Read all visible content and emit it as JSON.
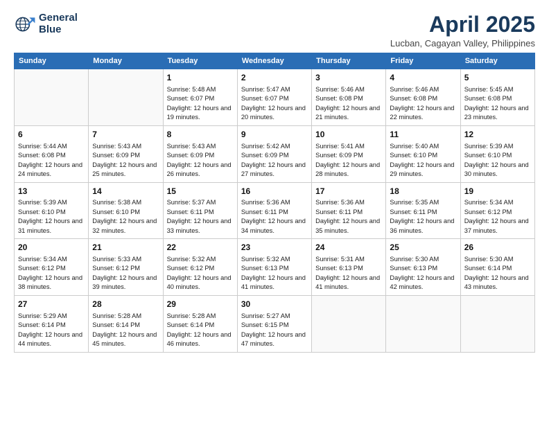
{
  "header": {
    "logo_line1": "General",
    "logo_line2": "Blue",
    "month_title": "April 2025",
    "subtitle": "Lucban, Cagayan Valley, Philippines"
  },
  "days_of_week": [
    "Sunday",
    "Monday",
    "Tuesday",
    "Wednesday",
    "Thursday",
    "Friday",
    "Saturday"
  ],
  "weeks": [
    [
      {
        "day": "",
        "sunrise": "",
        "sunset": "",
        "daylight": ""
      },
      {
        "day": "",
        "sunrise": "",
        "sunset": "",
        "daylight": ""
      },
      {
        "day": "1",
        "sunrise": "Sunrise: 5:48 AM",
        "sunset": "Sunset: 6:07 PM",
        "daylight": "Daylight: 12 hours and 19 minutes."
      },
      {
        "day": "2",
        "sunrise": "Sunrise: 5:47 AM",
        "sunset": "Sunset: 6:07 PM",
        "daylight": "Daylight: 12 hours and 20 minutes."
      },
      {
        "day": "3",
        "sunrise": "Sunrise: 5:46 AM",
        "sunset": "Sunset: 6:08 PM",
        "daylight": "Daylight: 12 hours and 21 minutes."
      },
      {
        "day": "4",
        "sunrise": "Sunrise: 5:46 AM",
        "sunset": "Sunset: 6:08 PM",
        "daylight": "Daylight: 12 hours and 22 minutes."
      },
      {
        "day": "5",
        "sunrise": "Sunrise: 5:45 AM",
        "sunset": "Sunset: 6:08 PM",
        "daylight": "Daylight: 12 hours and 23 minutes."
      }
    ],
    [
      {
        "day": "6",
        "sunrise": "Sunrise: 5:44 AM",
        "sunset": "Sunset: 6:08 PM",
        "daylight": "Daylight: 12 hours and 24 minutes."
      },
      {
        "day": "7",
        "sunrise": "Sunrise: 5:43 AM",
        "sunset": "Sunset: 6:09 PM",
        "daylight": "Daylight: 12 hours and 25 minutes."
      },
      {
        "day": "8",
        "sunrise": "Sunrise: 5:43 AM",
        "sunset": "Sunset: 6:09 PM",
        "daylight": "Daylight: 12 hours and 26 minutes."
      },
      {
        "day": "9",
        "sunrise": "Sunrise: 5:42 AM",
        "sunset": "Sunset: 6:09 PM",
        "daylight": "Daylight: 12 hours and 27 minutes."
      },
      {
        "day": "10",
        "sunrise": "Sunrise: 5:41 AM",
        "sunset": "Sunset: 6:09 PM",
        "daylight": "Daylight: 12 hours and 28 minutes."
      },
      {
        "day": "11",
        "sunrise": "Sunrise: 5:40 AM",
        "sunset": "Sunset: 6:10 PM",
        "daylight": "Daylight: 12 hours and 29 minutes."
      },
      {
        "day": "12",
        "sunrise": "Sunrise: 5:39 AM",
        "sunset": "Sunset: 6:10 PM",
        "daylight": "Daylight: 12 hours and 30 minutes."
      }
    ],
    [
      {
        "day": "13",
        "sunrise": "Sunrise: 5:39 AM",
        "sunset": "Sunset: 6:10 PM",
        "daylight": "Daylight: 12 hours and 31 minutes."
      },
      {
        "day": "14",
        "sunrise": "Sunrise: 5:38 AM",
        "sunset": "Sunset: 6:10 PM",
        "daylight": "Daylight: 12 hours and 32 minutes."
      },
      {
        "day": "15",
        "sunrise": "Sunrise: 5:37 AM",
        "sunset": "Sunset: 6:11 PM",
        "daylight": "Daylight: 12 hours and 33 minutes."
      },
      {
        "day": "16",
        "sunrise": "Sunrise: 5:36 AM",
        "sunset": "Sunset: 6:11 PM",
        "daylight": "Daylight: 12 hours and 34 minutes."
      },
      {
        "day": "17",
        "sunrise": "Sunrise: 5:36 AM",
        "sunset": "Sunset: 6:11 PM",
        "daylight": "Daylight: 12 hours and 35 minutes."
      },
      {
        "day": "18",
        "sunrise": "Sunrise: 5:35 AM",
        "sunset": "Sunset: 6:11 PM",
        "daylight": "Daylight: 12 hours and 36 minutes."
      },
      {
        "day": "19",
        "sunrise": "Sunrise: 5:34 AM",
        "sunset": "Sunset: 6:12 PM",
        "daylight": "Daylight: 12 hours and 37 minutes."
      }
    ],
    [
      {
        "day": "20",
        "sunrise": "Sunrise: 5:34 AM",
        "sunset": "Sunset: 6:12 PM",
        "daylight": "Daylight: 12 hours and 38 minutes."
      },
      {
        "day": "21",
        "sunrise": "Sunrise: 5:33 AM",
        "sunset": "Sunset: 6:12 PM",
        "daylight": "Daylight: 12 hours and 39 minutes."
      },
      {
        "day": "22",
        "sunrise": "Sunrise: 5:32 AM",
        "sunset": "Sunset: 6:12 PM",
        "daylight": "Daylight: 12 hours and 40 minutes."
      },
      {
        "day": "23",
        "sunrise": "Sunrise: 5:32 AM",
        "sunset": "Sunset: 6:13 PM",
        "daylight": "Daylight: 12 hours and 41 minutes."
      },
      {
        "day": "24",
        "sunrise": "Sunrise: 5:31 AM",
        "sunset": "Sunset: 6:13 PM",
        "daylight": "Daylight: 12 hours and 41 minutes."
      },
      {
        "day": "25",
        "sunrise": "Sunrise: 5:30 AM",
        "sunset": "Sunset: 6:13 PM",
        "daylight": "Daylight: 12 hours and 42 minutes."
      },
      {
        "day": "26",
        "sunrise": "Sunrise: 5:30 AM",
        "sunset": "Sunset: 6:14 PM",
        "daylight": "Daylight: 12 hours and 43 minutes."
      }
    ],
    [
      {
        "day": "27",
        "sunrise": "Sunrise: 5:29 AM",
        "sunset": "Sunset: 6:14 PM",
        "daylight": "Daylight: 12 hours and 44 minutes."
      },
      {
        "day": "28",
        "sunrise": "Sunrise: 5:28 AM",
        "sunset": "Sunset: 6:14 PM",
        "daylight": "Daylight: 12 hours and 45 minutes."
      },
      {
        "day": "29",
        "sunrise": "Sunrise: 5:28 AM",
        "sunset": "Sunset: 6:14 PM",
        "daylight": "Daylight: 12 hours and 46 minutes."
      },
      {
        "day": "30",
        "sunrise": "Sunrise: 5:27 AM",
        "sunset": "Sunset: 6:15 PM",
        "daylight": "Daylight: 12 hours and 47 minutes."
      },
      {
        "day": "",
        "sunrise": "",
        "sunset": "",
        "daylight": ""
      },
      {
        "day": "",
        "sunrise": "",
        "sunset": "",
        "daylight": ""
      },
      {
        "day": "",
        "sunrise": "",
        "sunset": "",
        "daylight": ""
      }
    ]
  ]
}
